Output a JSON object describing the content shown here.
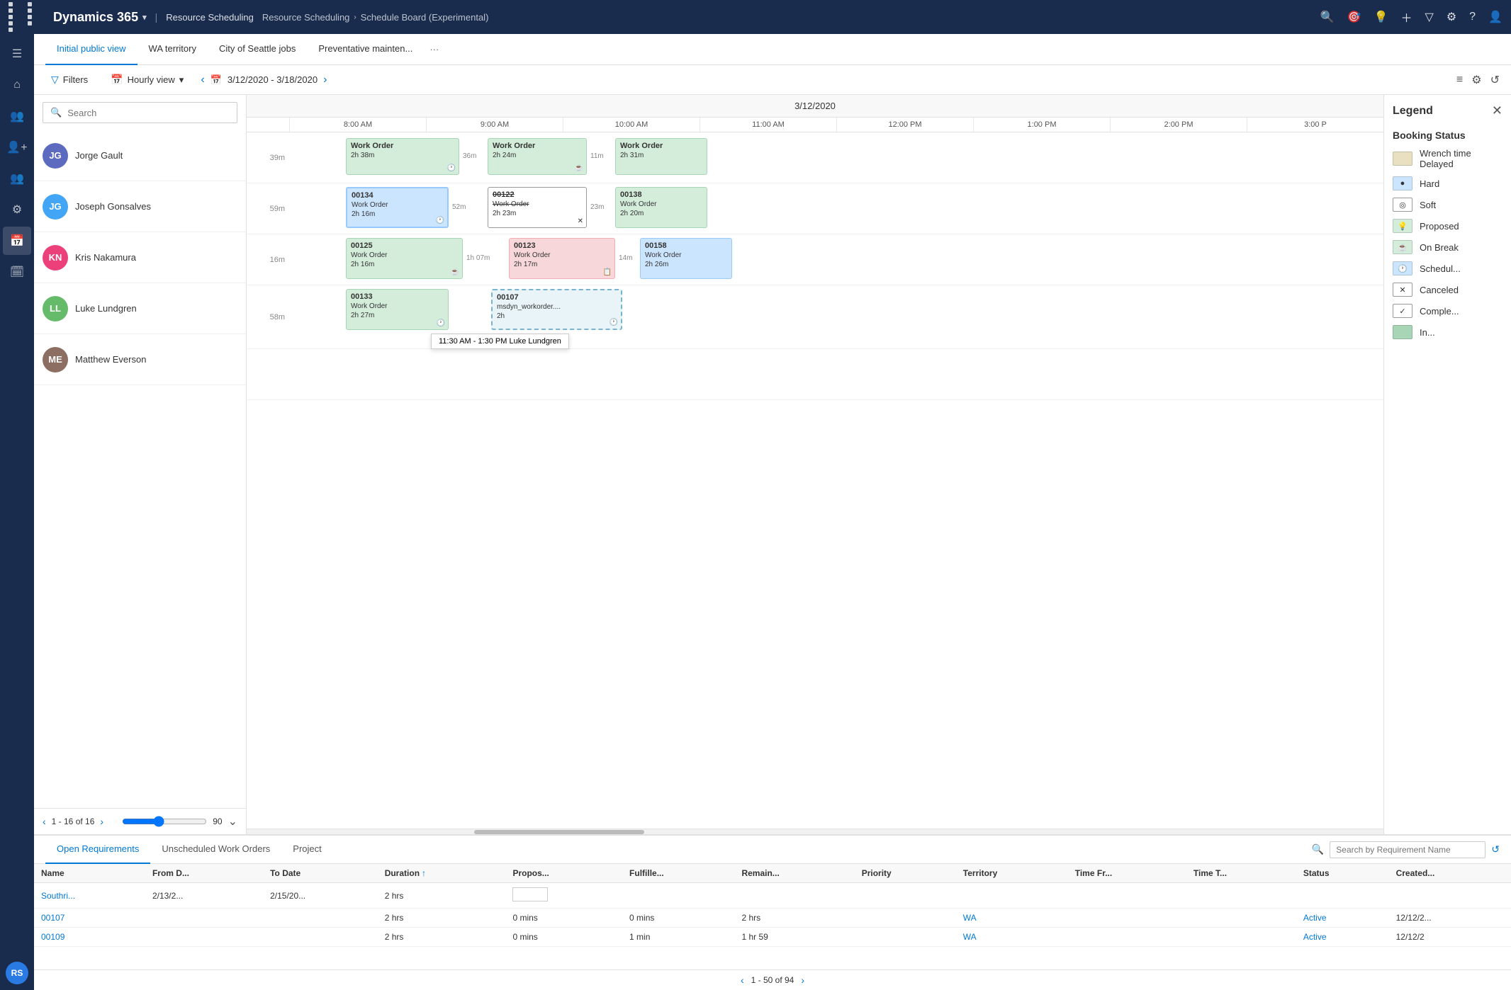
{
  "app": {
    "name": "Dynamics 365",
    "module": "Resource Scheduling",
    "breadcrumb": [
      "Resource Scheduling",
      "Schedule Board (Experimental)"
    ]
  },
  "nav_icons": [
    "grid-icon",
    "home-icon",
    "people-icon",
    "person-plus-icon",
    "group-icon",
    "person-settings-icon",
    "calendar-icon",
    "calendar-alt-icon"
  ],
  "tabs": [
    {
      "label": "Initial public view",
      "active": true
    },
    {
      "label": "WA territory",
      "active": false
    },
    {
      "label": "City of Seattle jobs",
      "active": false
    },
    {
      "label": "Preventative mainten...",
      "active": false
    }
  ],
  "toolbar": {
    "filters_label": "Filters",
    "view_label": "Hourly view",
    "date_range": "3/12/2020 - 3/18/2020",
    "date_header": "3/12/2020"
  },
  "search": {
    "placeholder": "Search"
  },
  "resources": [
    {
      "name": "Jorge Gault",
      "initials": "JG",
      "color": "#5c6bc0"
    },
    {
      "name": "Joseph Gonsalves",
      "initials": "JG2",
      "color": "#42a5f5"
    },
    {
      "name": "Kris Nakamura",
      "initials": "KN",
      "color": "#ec407a"
    },
    {
      "name": "Luke Lundgren",
      "initials": "LL",
      "color": "#66bb6a"
    },
    {
      "name": "Matthew Everson",
      "initials": "ME",
      "color": "#8d6e63"
    }
  ],
  "time_slots": [
    "8:00 AM",
    "9:00 AM",
    "10:00 AM",
    "11:00 AM",
    "12:00 PM",
    "1:00 PM",
    "2:00 PM",
    "3:00 P"
  ],
  "pagination": {
    "current": "1 - 16 of 16"
  },
  "zoom": {
    "value": "90"
  },
  "legend": {
    "title": "Legend",
    "section_title": "Booking Status",
    "items": [
      {
        "label": "Wrench time Delayed",
        "color": "#e8e0c0",
        "icon": ""
      },
      {
        "label": "Hard",
        "color": "#cce5ff",
        "icon": "●"
      },
      {
        "label": "Soft",
        "color": "#ffffff",
        "border": "#999",
        "icon": "◎"
      },
      {
        "label": "Proposed",
        "color": "#d4edda",
        "icon": "💡"
      },
      {
        "label": "On Break",
        "color": "#d4edda",
        "icon": "☕"
      },
      {
        "label": "Schedul...",
        "color": "#cce5ff",
        "icon": "🕐"
      },
      {
        "label": "Canceled",
        "color": "#ffffff",
        "border": "#999",
        "icon": "✕"
      },
      {
        "label": "Comple...",
        "color": "#ffffff",
        "border": "#999",
        "icon": "✓"
      },
      {
        "label": "In...",
        "color": "#a8d5b5",
        "icon": ""
      }
    ]
  },
  "lower_tabs": [
    {
      "label": "Open Requirements",
      "active": true
    },
    {
      "label": "Unscheduled Work Orders",
      "active": false
    },
    {
      "label": "Project",
      "active": false
    }
  ],
  "lower_search_placeholder": "Search by Requirement Name",
  "table_headers": [
    "Name",
    "From D...",
    "To Date",
    "Duration",
    "Propos...",
    "Fulfille...",
    "Remain...",
    "Priority",
    "Territory",
    "Time Fr...",
    "Time T...",
    "Status",
    "Created..."
  ],
  "table_rows": [
    {
      "name": "Southri...",
      "from": "2/13/2...",
      "to": "2/15/20...",
      "duration": "2 hrs",
      "proposed": "",
      "fulfilled": "",
      "remaining": "",
      "priority": "",
      "territory": "",
      "time_from": "",
      "time_to": "",
      "status": "",
      "created": ""
    },
    {
      "name": "00107",
      "from": "",
      "to": "",
      "duration": "2 hrs",
      "proposed": "0 mins",
      "fulfilled": "0 mins",
      "remaining": "2 hrs",
      "priority": "",
      "territory": "WA",
      "time_from": "",
      "time_to": "",
      "status": "Active",
      "created": "12/12/2..."
    },
    {
      "name": "00109",
      "from": "",
      "to": "",
      "duration": "2 hrs",
      "proposed": "0 mins",
      "fulfilled": "1 min",
      "remaining": "1 hr 59",
      "priority": "",
      "territory": "WA",
      "time_from": "",
      "time_to": "",
      "status": "Active",
      "created": "12/12/2"
    }
  ],
  "lower_pagination": {
    "text": "1 - 50 of 94"
  },
  "user_initials": "RS"
}
